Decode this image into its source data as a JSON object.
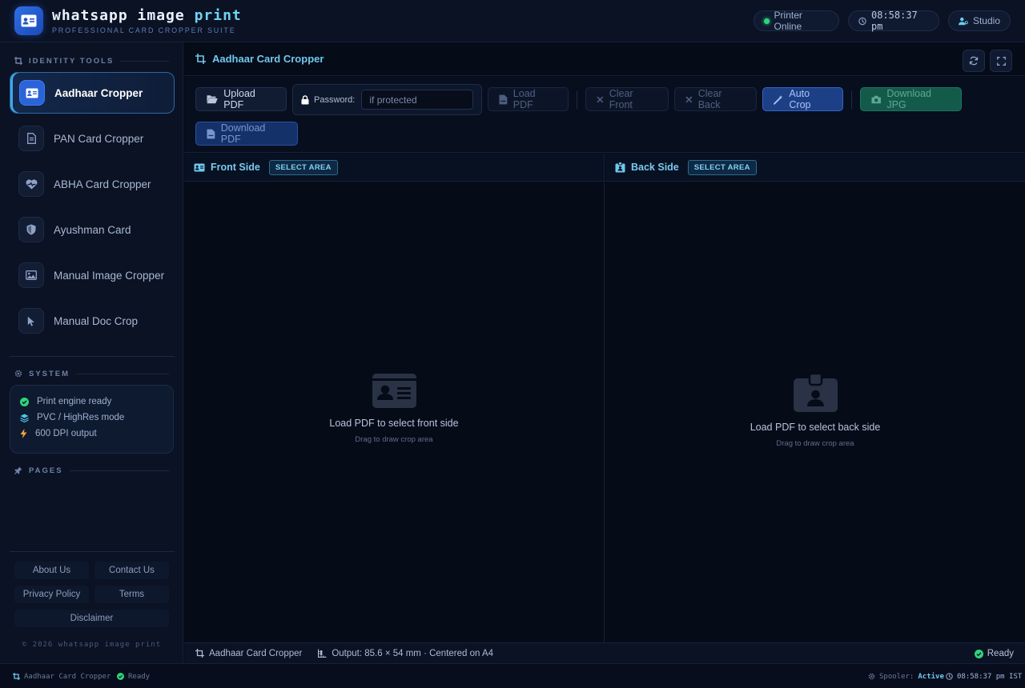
{
  "app": {
    "title_main": "whatsapp image",
    "title_accent": "print",
    "subtitle": "PROFESSIONAL CARD CROPPER SUITE"
  },
  "header": {
    "printer_status": "Printer Online",
    "clock": "08:58:37 pm",
    "studio_label": "Studio"
  },
  "sidebar": {
    "identity_heading": "IDENTITY TOOLS",
    "items": [
      {
        "label": "Aadhaar Cropper",
        "icon": "id-card-icon",
        "active": true
      },
      {
        "label": "PAN Card Cropper",
        "icon": "document-icon",
        "active": false
      },
      {
        "label": "ABHA Card Cropper",
        "icon": "heart-pulse-icon",
        "active": false
      },
      {
        "label": "Ayushman Card",
        "icon": "shield-icon",
        "active": false
      },
      {
        "label": "Manual Image Cropper",
        "icon": "image-icon",
        "active": false
      },
      {
        "label": "Manual Doc Crop",
        "icon": "cursor-icon",
        "active": false
      }
    ],
    "system_heading": "SYSTEM",
    "system_items": [
      {
        "label": "Print engine ready",
        "icon": "check-circle-icon"
      },
      {
        "label": "PVC / HighRes mode",
        "icon": "layers-icon"
      },
      {
        "label": "600 DPI output",
        "icon": "bolt-icon"
      }
    ],
    "pages_heading": "PAGES",
    "footer_links": [
      "About Us",
      "Contact Us",
      "Privacy Policy",
      "Terms",
      "Disclaimer"
    ],
    "copyright": "© 2026 whatsapp image print"
  },
  "main": {
    "title": "Aadhaar Card Cropper",
    "toolbar": {
      "upload_pdf": "Upload PDF",
      "password_label": "Password:",
      "password_placeholder": "if protected",
      "load_pdf": "Load PDF",
      "clear_front": "Clear Front",
      "clear_back": "Clear Back",
      "auto_crop": "Auto Crop",
      "download_jpg": "Download JPG",
      "download_pdf": "Download PDF"
    },
    "front": {
      "title": "Front Side",
      "tag": "SELECT AREA",
      "message": "Load PDF to select front side",
      "hint": "Drag to draw crop area"
    },
    "back": {
      "title": "Back Side",
      "tag": "SELECT AREA",
      "message": "Load PDF to select back side",
      "hint": "Drag to draw crop area"
    },
    "status": {
      "tool": "Aadhaar Card Cropper",
      "output": "Output: 85.6 × 54 mm · Centered on A4",
      "ready": "Ready"
    }
  },
  "sysbar": {
    "tool": "Aadhaar Card Cropper",
    "ready": "Ready",
    "spooler_label": "Spooler:",
    "spooler_value": "Active",
    "time": "08:58:37 pm IST"
  },
  "colors": {
    "background": "#060b18",
    "accent": "#6fc8ee",
    "primary_blue": "#2b63d8",
    "success_green": "#2ed47a"
  }
}
